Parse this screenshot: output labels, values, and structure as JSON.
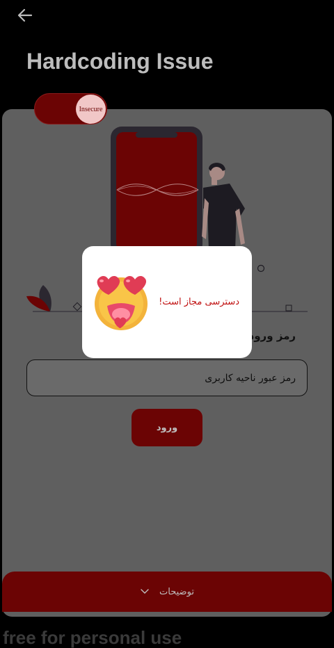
{
  "header": {
    "title": "Hardcoding Issue"
  },
  "toggle": {
    "label": "Insecure"
  },
  "form": {
    "heading": "رمز ورود",
    "password_value": "رمز عبور ناحیه کاربری",
    "submit_label": "ورود"
  },
  "dialog": {
    "message": "دسترسی مجاز است!"
  },
  "footer": {
    "label": "توضیحات"
  },
  "watermark": "free for personal use",
  "colors": {
    "accent": "#6b0404",
    "background": "#000000",
    "card": "#5f5f5f",
    "dialog_text": "#c01010"
  }
}
